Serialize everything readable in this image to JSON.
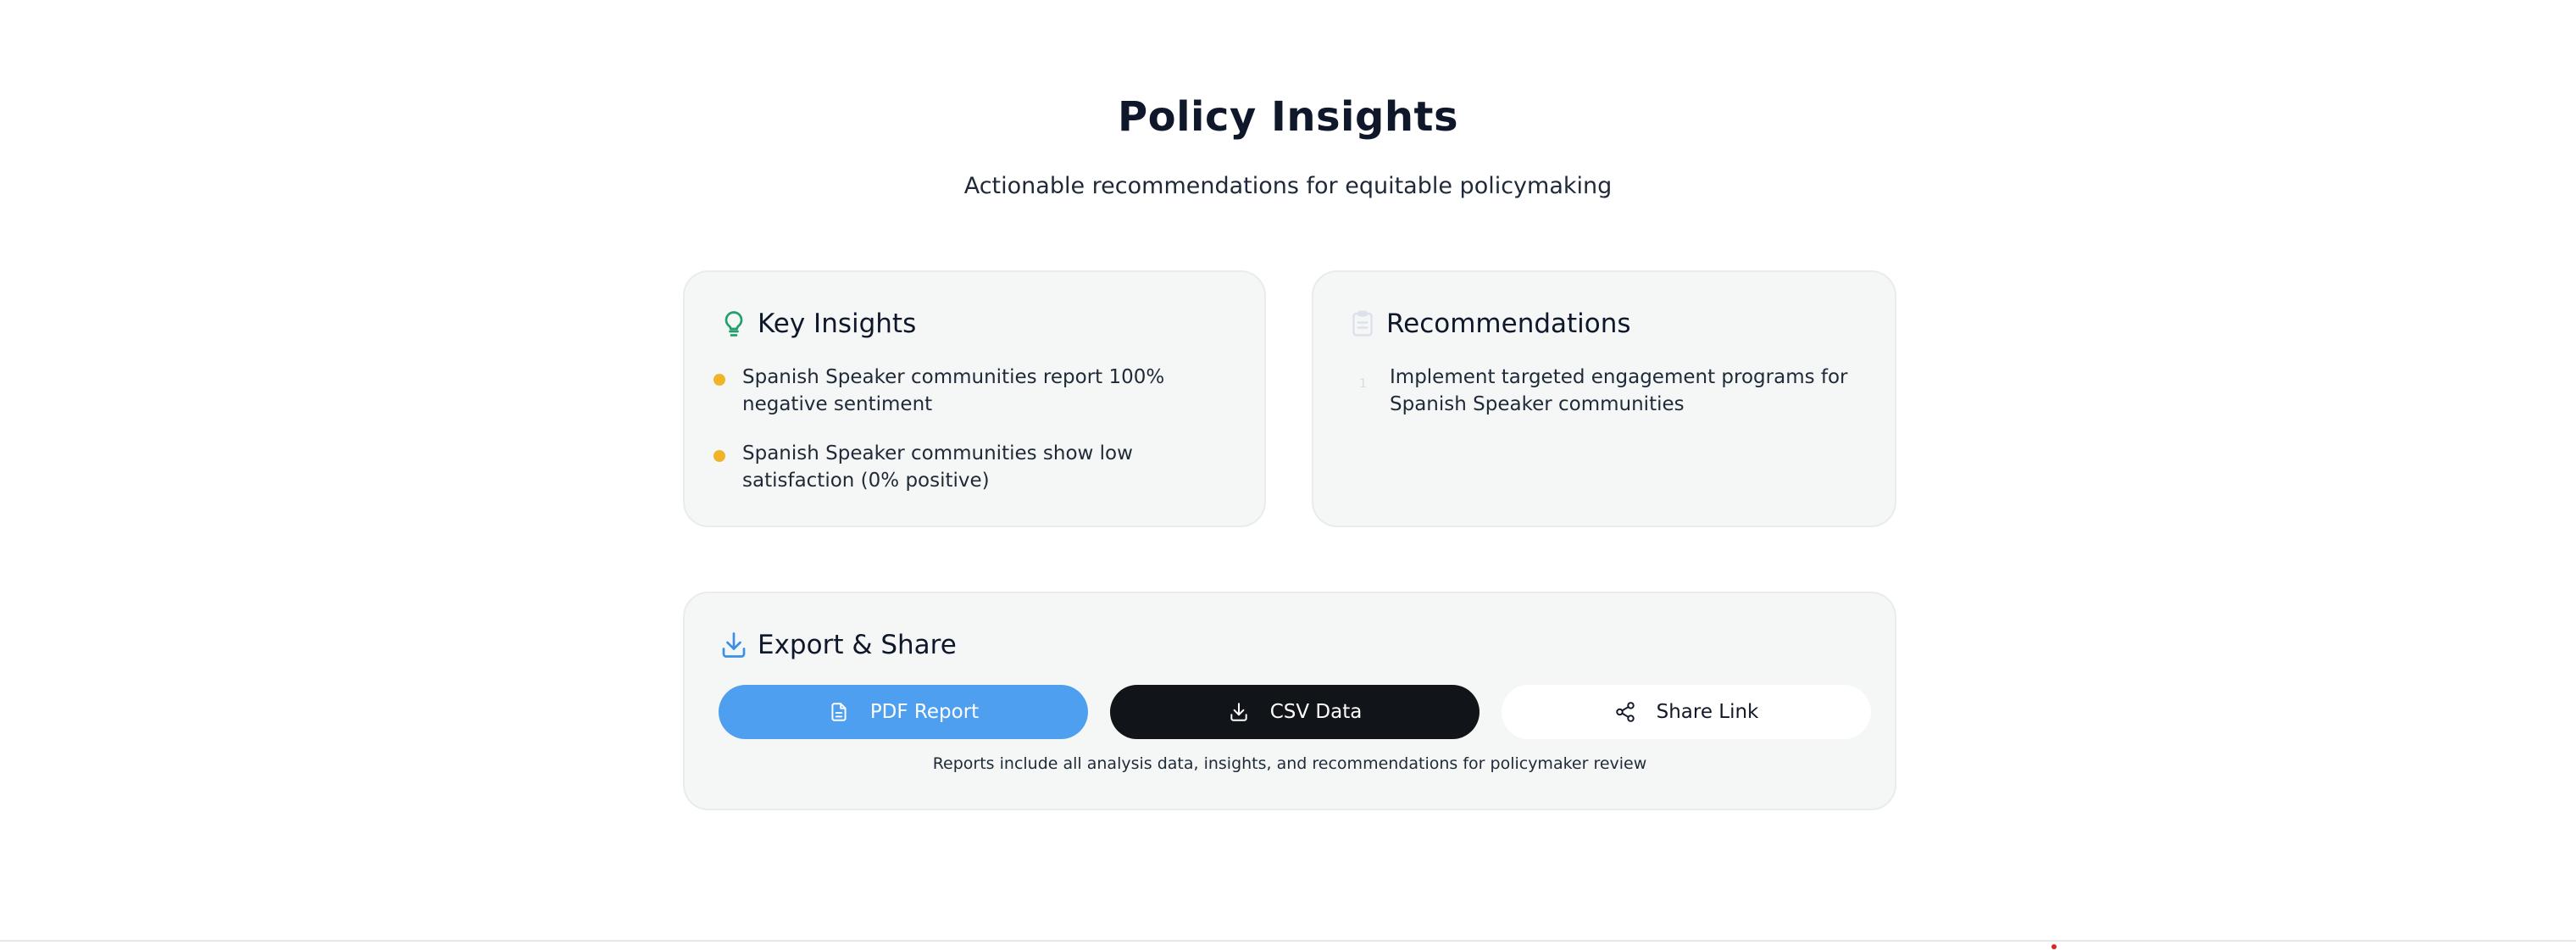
{
  "header": {
    "title": "Policy Insights",
    "subtitle": "Actionable recommendations for equitable policymaking"
  },
  "key_insights": {
    "title": "Key Insights",
    "icon": "lightbulb-icon",
    "items": [
      "Spanish Speaker communities report 100% negative sentiment",
      "Spanish Speaker communities show low satisfaction (0% positive)"
    ]
  },
  "recommendations": {
    "title": "Recommendations",
    "icon": "clipboard-icon",
    "items": [
      {
        "number": "1",
        "text": "Implement targeted engagement programs for Spanish Speaker communities"
      }
    ]
  },
  "export": {
    "title": "Export & Share",
    "icon": "download-icon",
    "buttons": {
      "pdf": "PDF Report",
      "csv": "CSV Data",
      "share": "Share Link"
    },
    "note": "Reports include all analysis data, insights, and recommendations for policymaker review"
  },
  "colors": {
    "accent_blue": "#4f9ff0",
    "dark": "#111418",
    "bullet_yellow": "#f0b429",
    "insight_icon_green": "#22a06b",
    "card_bg": "#f5f7f7"
  }
}
